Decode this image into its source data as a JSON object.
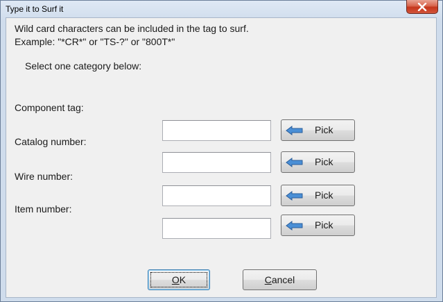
{
  "window": {
    "title": "Type it to Surf it"
  },
  "intro": {
    "line1": "Wild card characters can be included in the tag to surf.",
    "line2": "Example: \"*CR*\" or \"TS-?\" or \"800T*\""
  },
  "prompt": "Select one category below:",
  "fields": [
    {
      "label": "Component tag:",
      "value": "",
      "pick": "Pick"
    },
    {
      "label": "Catalog number:",
      "value": "",
      "pick": "Pick"
    },
    {
      "label": "Wire number:",
      "value": "",
      "pick": "Pick"
    },
    {
      "label": "Item number:",
      "value": "",
      "pick": "Pick"
    }
  ],
  "buttons": {
    "ok_accel": "O",
    "ok_rest": "K",
    "cancel_accel": "C",
    "cancel_rest": "ancel"
  },
  "icons": {
    "close": "close-x-icon",
    "pick": "left-arrow-icon"
  },
  "colors": {
    "arrow_fill": "#4a8fd6",
    "close_bg": "#c9452b"
  }
}
